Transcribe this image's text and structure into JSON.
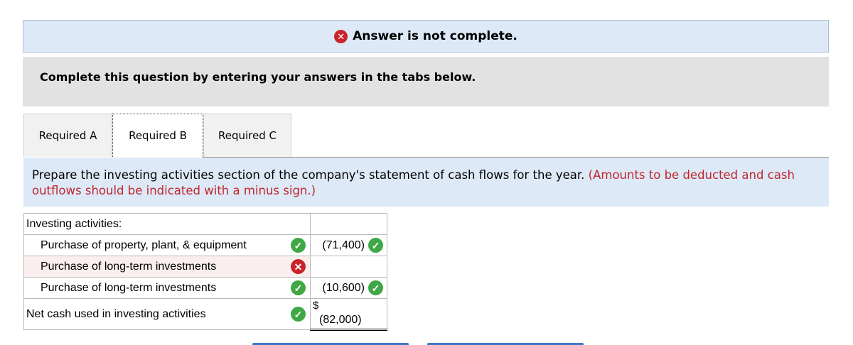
{
  "banner": {
    "status_text": "Answer is not complete."
  },
  "instructions": {
    "text": "Complete this question by entering your answers in the tabs below."
  },
  "tabs": [
    {
      "label": "Required A"
    },
    {
      "label": "Required B",
      "active": true
    },
    {
      "label": "Required C"
    }
  ],
  "prompt": {
    "main": "Prepare the investing activities section of the company's statement of cash flows for the year.",
    "note": "(Amounts to be deducted and cash outflows should be indicated with a minus sign.)"
  },
  "table": {
    "heading": "Investing activities:",
    "rows": [
      {
        "label": "Purchase of property, plant, & equipment",
        "label_status": "correct",
        "value": "(71,400)",
        "value_status": "correct"
      },
      {
        "label": "Purchase of long-term investments",
        "label_status": "incorrect",
        "value": "",
        "value_status": "none"
      },
      {
        "label": "Purchase of long-term investments",
        "label_status": "correct",
        "value": "(10,600)",
        "value_status": "correct"
      }
    ],
    "total": {
      "label": "Net cash used in investing activities",
      "label_status": "correct",
      "currency": "$",
      "value": "(82,000)"
    }
  },
  "colors": {
    "correct": "#3fa845",
    "incorrect": "#c9242b",
    "banner_bg": "#dde9f7",
    "note_red": "#c0262d"
  }
}
